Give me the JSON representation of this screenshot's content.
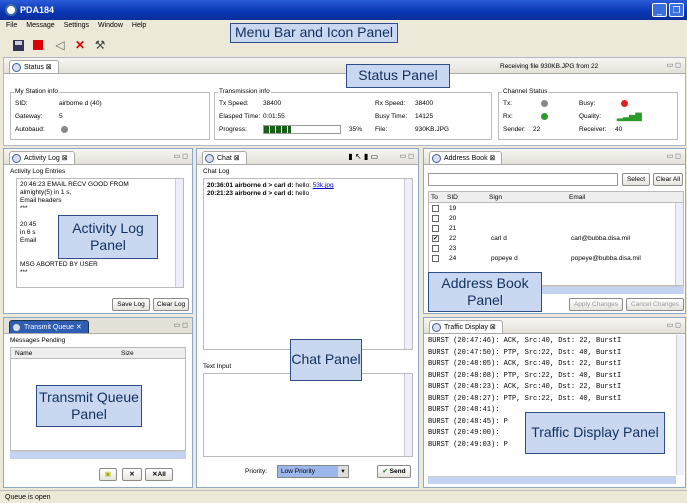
{
  "window": {
    "title": "PDA184"
  },
  "menu": [
    "File",
    "Message",
    "Settings",
    "Window",
    "Help"
  ],
  "status": {
    "tab": "Status",
    "receiving": "Receiving file 930KB.JPG from 22",
    "my_station": {
      "label": "My Station info",
      "sid_lbl": "SID:",
      "sid": "airborne d (40)",
      "gw_lbl": "Gateway:",
      "gw": "5",
      "ab_lbl": "Autobaud:"
    },
    "tx": {
      "label": "Transmission info",
      "txs_lbl": "Tx Speed:",
      "txs": "38400",
      "elapsed_lbl": "Elasped Time:",
      "elapsed": "0:01:55",
      "prog_lbl": "Progress:",
      "prog_pct": "35%",
      "progress": 0.35,
      "rxs_lbl": "Rx Speed:",
      "rxs": "38400",
      "busy_lbl": "Busy Time:",
      "busy": "14125",
      "file_lbl": "File:",
      "file": "930KB.JPG"
    },
    "channel": {
      "label": "Channel Status",
      "tx_lbl": "Tx:",
      "rx_lbl": "Rx:",
      "busy_lbl": "Busy:",
      "quality_lbl": "Quality:",
      "sender_lbl": "Sender:",
      "sender": "22",
      "receiver_lbl": "Receiver:",
      "receiver": "40"
    }
  },
  "activity": {
    "tab": "Activity Log",
    "group": "Activity Log Entries",
    "lines": [
      "20:46:23 EMAIL RECV GOOD FROM",
      "almighty(5) in 1 s,",
      "Email headers",
      "***",
      "",
      "20:45",
      "in 6 s",
      "Email",
      "",
      "",
      "MSG ABORTED BY USER",
      "***"
    ],
    "save": "Save Log",
    "clear": "Clear Log"
  },
  "chat": {
    "tab": "Chat",
    "log_lbl": "Chat Log",
    "lines": [
      {
        "pre": "20:36:01 airborne d > carl d:",
        "msg": " hello: ",
        "link": "53k.jpg"
      },
      {
        "pre": "20:21:23 airborne d > carl d:",
        "msg": " hello",
        "link": ""
      }
    ],
    "input_lbl": "Text Input",
    "priority_lbl": "Priority:",
    "priority": "Low Priority",
    "send": "Send"
  },
  "address": {
    "tab": "Address Book",
    "select": "Select",
    "clear_all": "Clear All",
    "cols": [
      "To",
      "SID",
      "Sign",
      "Email"
    ],
    "rows": [
      {
        "sid": "19",
        "sign": "",
        "email": "",
        "chk": false
      },
      {
        "sid": "20",
        "sign": "",
        "email": "",
        "chk": false
      },
      {
        "sid": "21",
        "sign": "",
        "email": "",
        "chk": false
      },
      {
        "sid": "22",
        "sign": "carl d",
        "email": "carl@bubba.disa.mil",
        "chk": true
      },
      {
        "sid": "23",
        "sign": "",
        "email": "",
        "chk": false
      },
      {
        "sid": "24",
        "sign": "popeye d",
        "email": "popeye@bubba.disa.mil",
        "chk": false
      }
    ],
    "apply": "Apply Changes",
    "cancel": "Cancel Changes"
  },
  "queue": {
    "tab": "Transmit Queue",
    "group": "Messages Pending",
    "cols": [
      "Name",
      "Size"
    ]
  },
  "traffic": {
    "tab": "Traffic Display",
    "lines": [
      "BURST (20:47:46): ACK, Src:40, Dst: 22, BurstI",
      "BURST (20:47:50): PTP, Src:22, Dst: 40, BurstI",
      "BURST (20:48:05): ACK, Src:40, Dst: 22, BurstI",
      "BURST (20:48:08): PTP, Src:22, Dst: 40, BurstI",
      "BURST (20:48:23): ACK, Src:40, Dst: 22, BurstI",
      "BURST (20:48:27): PTP, Src:22, Dst: 40, BurstI",
      "BURST (20:48:41): ",
      "BURST (20:48:45): P",
      "BURST (20:49:00): ",
      "BURST (20:49:03): P"
    ]
  },
  "callouts": {
    "menu": "Menu Bar and Icon Panel",
    "status": "Status Panel",
    "activity": "Activity Log Panel",
    "addressbook": "Address Book Panel",
    "chat": "Chat Panel",
    "queue": "Transmit Queue Panel",
    "traffic": "Traffic Display Panel"
  },
  "statusbar": "Queue is open",
  "colors": {
    "red": "#e02020",
    "green": "#2a9a2a",
    "accent": "#2c4f8a"
  }
}
